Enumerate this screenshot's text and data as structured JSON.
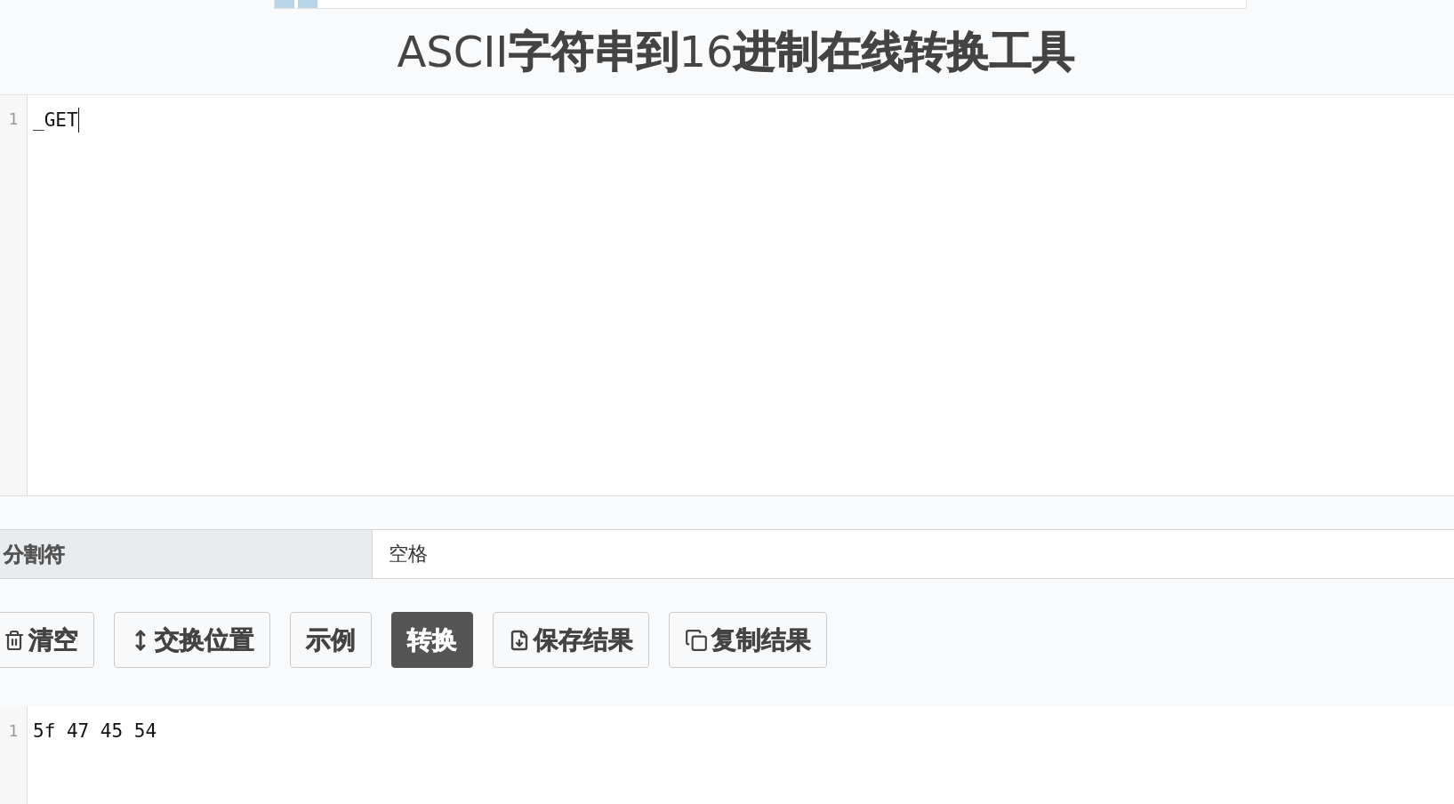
{
  "title": "ASCII**字符串到**16**进制在线转换工具**",
  "input_editor": {
    "lines": [
      {
        "number": "1",
        "text": "_GET"
      }
    ]
  },
  "delimiter": {
    "label": "分割符",
    "value": "空格"
  },
  "buttons": [
    {
      "label": "清空",
      "selected": false
    },
    {
      "label": "交换位置",
      "selected": false
    },
    {
      "label": "示例",
      "selected": false
    },
    {
      "label": "转换",
      "selected": true
    },
    {
      "label": "保存结果",
      "selected": false
    },
    {
      "label": "复制结果",
      "selected": false
    }
  ],
  "output_editor": {
    "lines": [
      {
        "number": "1",
        "text": "5f 47 45 54"
      }
    ]
  }
}
